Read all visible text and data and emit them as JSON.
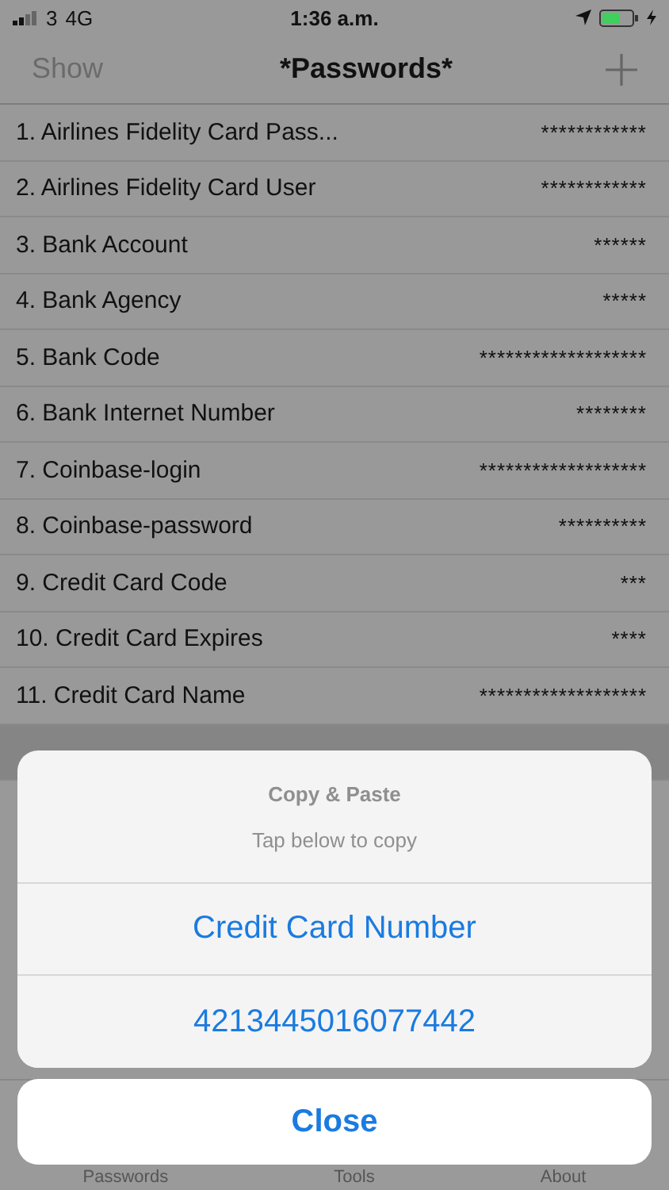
{
  "status_bar": {
    "signal": "3",
    "network": "4G",
    "time": "1:36 a.m."
  },
  "nav": {
    "left": "Show",
    "title": "*Passwords*"
  },
  "rows": [
    {
      "label": "1. Airlines Fidelity Card Pass...",
      "value": "************",
      "selected": false
    },
    {
      "label": "2. Airlines Fidelity Card User",
      "value": "************",
      "selected": false
    },
    {
      "label": "3. Bank Account",
      "value": "******",
      "selected": false
    },
    {
      "label": "4. Bank Agency",
      "value": "*****",
      "selected": false
    },
    {
      "label": "5. Bank Code",
      "value": "*******************",
      "selected": false
    },
    {
      "label": "6. Bank Internet Number",
      "value": "********",
      "selected": false
    },
    {
      "label": "7. Coinbase-login",
      "value": "*******************",
      "selected": false
    },
    {
      "label": "8. Coinbase-password",
      "value": "**********",
      "selected": false
    },
    {
      "label": "9. Credit Card Code",
      "value": "***",
      "selected": false
    },
    {
      "label": "10. Credit Card Expires",
      "value": "****",
      "selected": false
    },
    {
      "label": "11. Credit Card Name",
      "value": "*******************",
      "selected": false
    },
    {
      "selected": true
    }
  ],
  "sheet": {
    "title": "Copy & Paste",
    "subtitle": "Tap below to copy",
    "actions": [
      "Credit Card Number",
      "4213445016077442"
    ],
    "cancel": "Close"
  },
  "tabs": [
    "Passwords",
    "Tools",
    "About"
  ]
}
